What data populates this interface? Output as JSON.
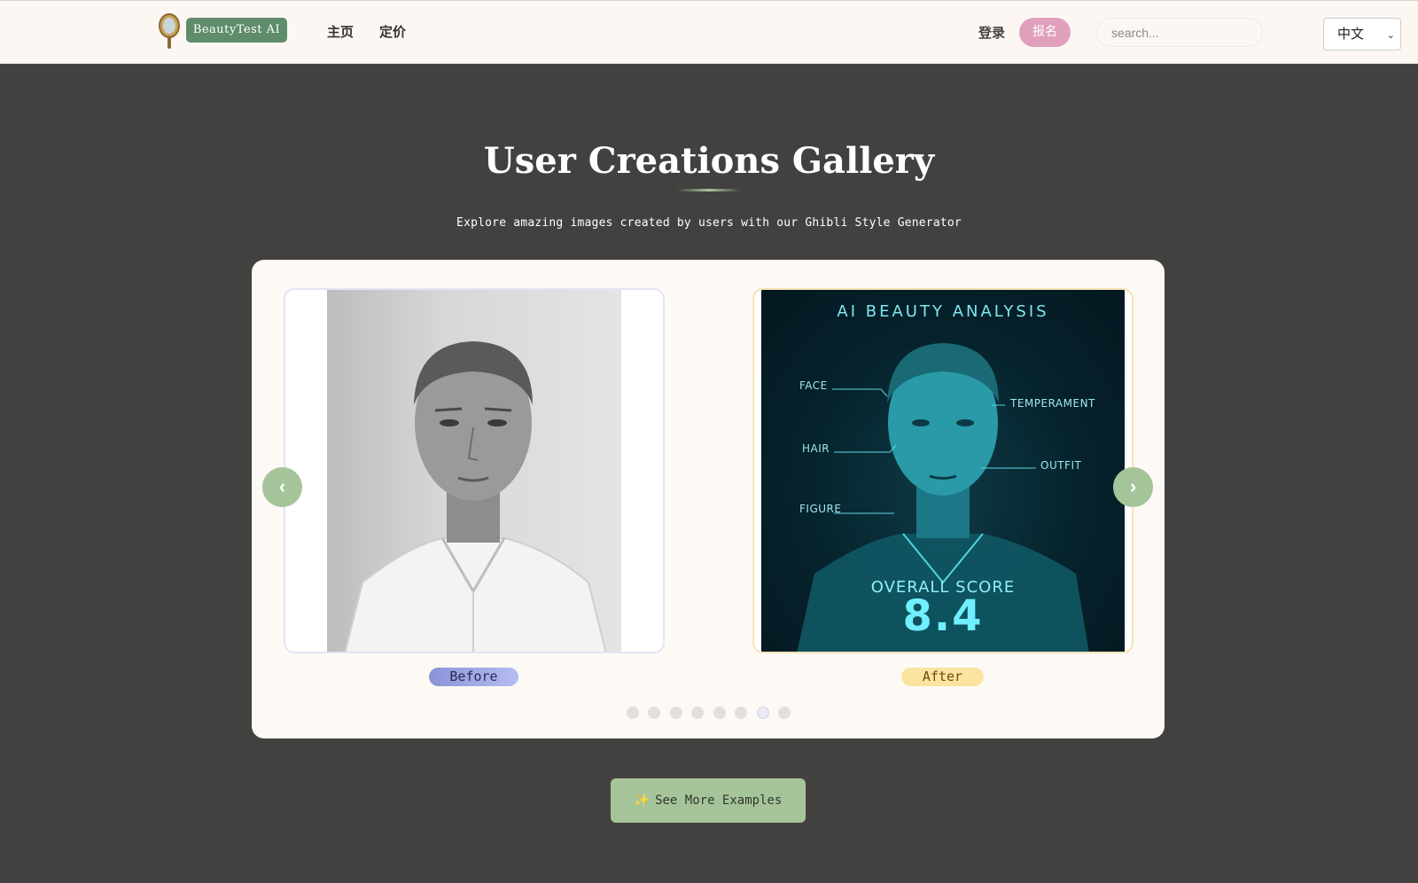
{
  "header": {
    "logo_text": "BeautyTest AI",
    "nav": [
      {
        "label": "主页"
      },
      {
        "label": "定价"
      }
    ],
    "login_label": "登录",
    "signup_label": "报名",
    "search_placeholder": "search...",
    "language": "中文"
  },
  "gallery": {
    "title": "User Creations Gallery",
    "subtitle": "Explore amazing images created by users with our Ghibli Style Generator",
    "before_label": "Before",
    "after_label": "After",
    "after_image": {
      "title": "AI BEAUTY ANALYSIS",
      "tags": [
        "FACE",
        "TEMPERAMENT",
        "HAIR",
        "OUTFIT",
        "FIGURE"
      ],
      "score_label": "OVERALL SCORE",
      "score": "8.4"
    },
    "prev_icon": "‹",
    "next_icon": "›",
    "dots": [
      false,
      false,
      false,
      false,
      false,
      false,
      true,
      false
    ],
    "cta_label": "See More Examples",
    "cta_icon": "✨"
  },
  "colors": {
    "page_bg": "#43413f",
    "header_bg": "#fdf7f4",
    "accent_green": "#a6c49a",
    "accent_pink": "#e0a0bc",
    "before_pill": "#8b93d8",
    "after_pill": "#fbe3a0"
  }
}
